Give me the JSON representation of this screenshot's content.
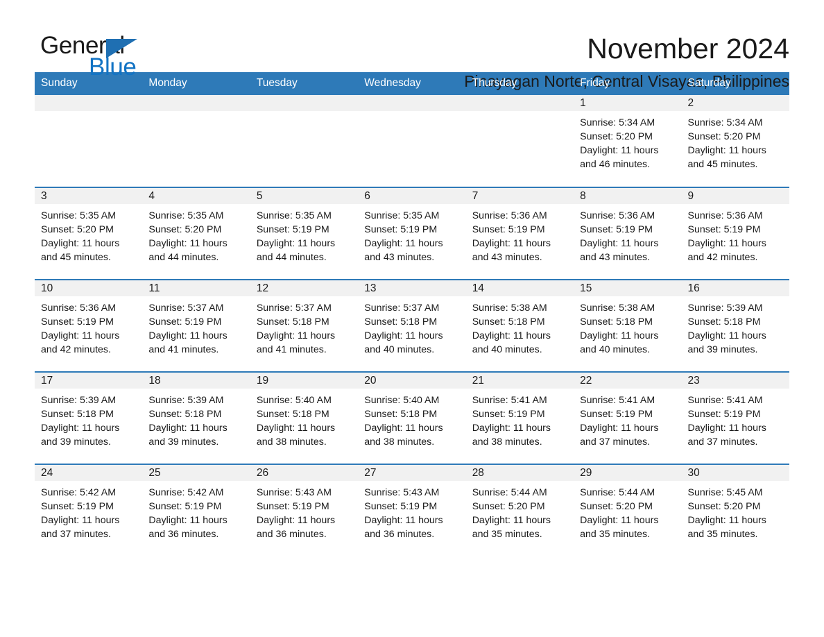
{
  "brand": {
    "name_part1": "General",
    "name_part2": "Blue",
    "triangle_icon": "brand-triangle-icon",
    "accent_color": "#1273c4"
  },
  "header": {
    "month_title": "November 2024",
    "location": "Pinayagan Norte, Central Visayas, Philippines"
  },
  "theme": {
    "header_row_color": "#2e7ab8",
    "daynum_band_color": "#f1f1f1",
    "row_divider_color": "#2e7ab8",
    "text_color": "#1a1a1a",
    "page_background": "#ffffff"
  },
  "calendar": {
    "day_headers": [
      "Sunday",
      "Monday",
      "Tuesday",
      "Wednesday",
      "Thursday",
      "Friday",
      "Saturday"
    ],
    "weeks": [
      [
        {
          "day": "",
          "blank": true,
          "sunrise": "",
          "sunset": "",
          "daylight_line1": "",
          "daylight_line2": ""
        },
        {
          "day": "",
          "blank": true,
          "sunrise": "",
          "sunset": "",
          "daylight_line1": "",
          "daylight_line2": ""
        },
        {
          "day": "",
          "blank": true,
          "sunrise": "",
          "sunset": "",
          "daylight_line1": "",
          "daylight_line2": ""
        },
        {
          "day": "",
          "blank": true,
          "sunrise": "",
          "sunset": "",
          "daylight_line1": "",
          "daylight_line2": ""
        },
        {
          "day": "",
          "blank": true,
          "sunrise": "",
          "sunset": "",
          "daylight_line1": "",
          "daylight_line2": ""
        },
        {
          "day": "1",
          "blank": false,
          "sunrise": "Sunrise: 5:34 AM",
          "sunset": "Sunset: 5:20 PM",
          "daylight_line1": "Daylight: 11 hours",
          "daylight_line2": "and 46 minutes."
        },
        {
          "day": "2",
          "blank": false,
          "sunrise": "Sunrise: 5:34 AM",
          "sunset": "Sunset: 5:20 PM",
          "daylight_line1": "Daylight: 11 hours",
          "daylight_line2": "and 45 minutes."
        }
      ],
      [
        {
          "day": "3",
          "blank": false,
          "sunrise": "Sunrise: 5:35 AM",
          "sunset": "Sunset: 5:20 PM",
          "daylight_line1": "Daylight: 11 hours",
          "daylight_line2": "and 45 minutes."
        },
        {
          "day": "4",
          "blank": false,
          "sunrise": "Sunrise: 5:35 AM",
          "sunset": "Sunset: 5:20 PM",
          "daylight_line1": "Daylight: 11 hours",
          "daylight_line2": "and 44 minutes."
        },
        {
          "day": "5",
          "blank": false,
          "sunrise": "Sunrise: 5:35 AM",
          "sunset": "Sunset: 5:19 PM",
          "daylight_line1": "Daylight: 11 hours",
          "daylight_line2": "and 44 minutes."
        },
        {
          "day": "6",
          "blank": false,
          "sunrise": "Sunrise: 5:35 AM",
          "sunset": "Sunset: 5:19 PM",
          "daylight_line1": "Daylight: 11 hours",
          "daylight_line2": "and 43 minutes."
        },
        {
          "day": "7",
          "blank": false,
          "sunrise": "Sunrise: 5:36 AM",
          "sunset": "Sunset: 5:19 PM",
          "daylight_line1": "Daylight: 11 hours",
          "daylight_line2": "and 43 minutes."
        },
        {
          "day": "8",
          "blank": false,
          "sunrise": "Sunrise: 5:36 AM",
          "sunset": "Sunset: 5:19 PM",
          "daylight_line1": "Daylight: 11 hours",
          "daylight_line2": "and 43 minutes."
        },
        {
          "day": "9",
          "blank": false,
          "sunrise": "Sunrise: 5:36 AM",
          "sunset": "Sunset: 5:19 PM",
          "daylight_line1": "Daylight: 11 hours",
          "daylight_line2": "and 42 minutes."
        }
      ],
      [
        {
          "day": "10",
          "blank": false,
          "sunrise": "Sunrise: 5:36 AM",
          "sunset": "Sunset: 5:19 PM",
          "daylight_line1": "Daylight: 11 hours",
          "daylight_line2": "and 42 minutes."
        },
        {
          "day": "11",
          "blank": false,
          "sunrise": "Sunrise: 5:37 AM",
          "sunset": "Sunset: 5:19 PM",
          "daylight_line1": "Daylight: 11 hours",
          "daylight_line2": "and 41 minutes."
        },
        {
          "day": "12",
          "blank": false,
          "sunrise": "Sunrise: 5:37 AM",
          "sunset": "Sunset: 5:18 PM",
          "daylight_line1": "Daylight: 11 hours",
          "daylight_line2": "and 41 minutes."
        },
        {
          "day": "13",
          "blank": false,
          "sunrise": "Sunrise: 5:37 AM",
          "sunset": "Sunset: 5:18 PM",
          "daylight_line1": "Daylight: 11 hours",
          "daylight_line2": "and 40 minutes."
        },
        {
          "day": "14",
          "blank": false,
          "sunrise": "Sunrise: 5:38 AM",
          "sunset": "Sunset: 5:18 PM",
          "daylight_line1": "Daylight: 11 hours",
          "daylight_line2": "and 40 minutes."
        },
        {
          "day": "15",
          "blank": false,
          "sunrise": "Sunrise: 5:38 AM",
          "sunset": "Sunset: 5:18 PM",
          "daylight_line1": "Daylight: 11 hours",
          "daylight_line2": "and 40 minutes."
        },
        {
          "day": "16",
          "blank": false,
          "sunrise": "Sunrise: 5:39 AM",
          "sunset": "Sunset: 5:18 PM",
          "daylight_line1": "Daylight: 11 hours",
          "daylight_line2": "and 39 minutes."
        }
      ],
      [
        {
          "day": "17",
          "blank": false,
          "sunrise": "Sunrise: 5:39 AM",
          "sunset": "Sunset: 5:18 PM",
          "daylight_line1": "Daylight: 11 hours",
          "daylight_line2": "and 39 minutes."
        },
        {
          "day": "18",
          "blank": false,
          "sunrise": "Sunrise: 5:39 AM",
          "sunset": "Sunset: 5:18 PM",
          "daylight_line1": "Daylight: 11 hours",
          "daylight_line2": "and 39 minutes."
        },
        {
          "day": "19",
          "blank": false,
          "sunrise": "Sunrise: 5:40 AM",
          "sunset": "Sunset: 5:18 PM",
          "daylight_line1": "Daylight: 11 hours",
          "daylight_line2": "and 38 minutes."
        },
        {
          "day": "20",
          "blank": false,
          "sunrise": "Sunrise: 5:40 AM",
          "sunset": "Sunset: 5:18 PM",
          "daylight_line1": "Daylight: 11 hours",
          "daylight_line2": "and 38 minutes."
        },
        {
          "day": "21",
          "blank": false,
          "sunrise": "Sunrise: 5:41 AM",
          "sunset": "Sunset: 5:19 PM",
          "daylight_line1": "Daylight: 11 hours",
          "daylight_line2": "and 38 minutes."
        },
        {
          "day": "22",
          "blank": false,
          "sunrise": "Sunrise: 5:41 AM",
          "sunset": "Sunset: 5:19 PM",
          "daylight_line1": "Daylight: 11 hours",
          "daylight_line2": "and 37 minutes."
        },
        {
          "day": "23",
          "blank": false,
          "sunrise": "Sunrise: 5:41 AM",
          "sunset": "Sunset: 5:19 PM",
          "daylight_line1": "Daylight: 11 hours",
          "daylight_line2": "and 37 minutes."
        }
      ],
      [
        {
          "day": "24",
          "blank": false,
          "sunrise": "Sunrise: 5:42 AM",
          "sunset": "Sunset: 5:19 PM",
          "daylight_line1": "Daylight: 11 hours",
          "daylight_line2": "and 37 minutes."
        },
        {
          "day": "25",
          "blank": false,
          "sunrise": "Sunrise: 5:42 AM",
          "sunset": "Sunset: 5:19 PM",
          "daylight_line1": "Daylight: 11 hours",
          "daylight_line2": "and 36 minutes."
        },
        {
          "day": "26",
          "blank": false,
          "sunrise": "Sunrise: 5:43 AM",
          "sunset": "Sunset: 5:19 PM",
          "daylight_line1": "Daylight: 11 hours",
          "daylight_line2": "and 36 minutes."
        },
        {
          "day": "27",
          "blank": false,
          "sunrise": "Sunrise: 5:43 AM",
          "sunset": "Sunset: 5:19 PM",
          "daylight_line1": "Daylight: 11 hours",
          "daylight_line2": "and 36 minutes."
        },
        {
          "day": "28",
          "blank": false,
          "sunrise": "Sunrise: 5:44 AM",
          "sunset": "Sunset: 5:20 PM",
          "daylight_line1": "Daylight: 11 hours",
          "daylight_line2": "and 35 minutes."
        },
        {
          "day": "29",
          "blank": false,
          "sunrise": "Sunrise: 5:44 AM",
          "sunset": "Sunset: 5:20 PM",
          "daylight_line1": "Daylight: 11 hours",
          "daylight_line2": "and 35 minutes."
        },
        {
          "day": "30",
          "blank": false,
          "sunrise": "Sunrise: 5:45 AM",
          "sunset": "Sunset: 5:20 PM",
          "daylight_line1": "Daylight: 11 hours",
          "daylight_line2": "and 35 minutes."
        }
      ]
    ]
  }
}
